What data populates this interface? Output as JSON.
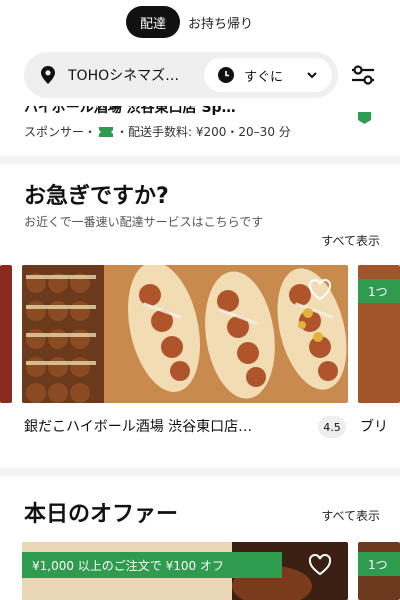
{
  "mode_toggle": {
    "delivery": "配達",
    "pickup": "お持ち帰り"
  },
  "location_bar": {
    "location": "TOHOシネマズ…",
    "time": "すぐに"
  },
  "sponsored": {
    "title": "ハイボール酒場 渋谷東口店 Sp…",
    "meta_prefix": "スポンサー・",
    "meta_suffix": "・配送手数料: ¥200・20–30 分"
  },
  "section_hurry": {
    "title": "お急ぎですか?",
    "subtitle": "お近くで一番速い配達サービスはこちらです",
    "see_all": "すべて表示",
    "cards": [
      {
        "name": "銀だこハイボール酒場 渋谷東口店…",
        "rating": "4.5"
      },
      {
        "name": "ブリ",
        "tag": "1つ"
      }
    ]
  },
  "section_offers": {
    "title": "本日のオファー",
    "see_all": "すべて表示",
    "cards": [
      {
        "promo": "¥1,000 以上のご注文で ¥100 オフ"
      },
      {
        "tag": "1つ"
      }
    ]
  },
  "colors": {
    "accent_green": "#2f9b4f",
    "pill_dark": "#111111",
    "bar_bg": "#efefef"
  }
}
